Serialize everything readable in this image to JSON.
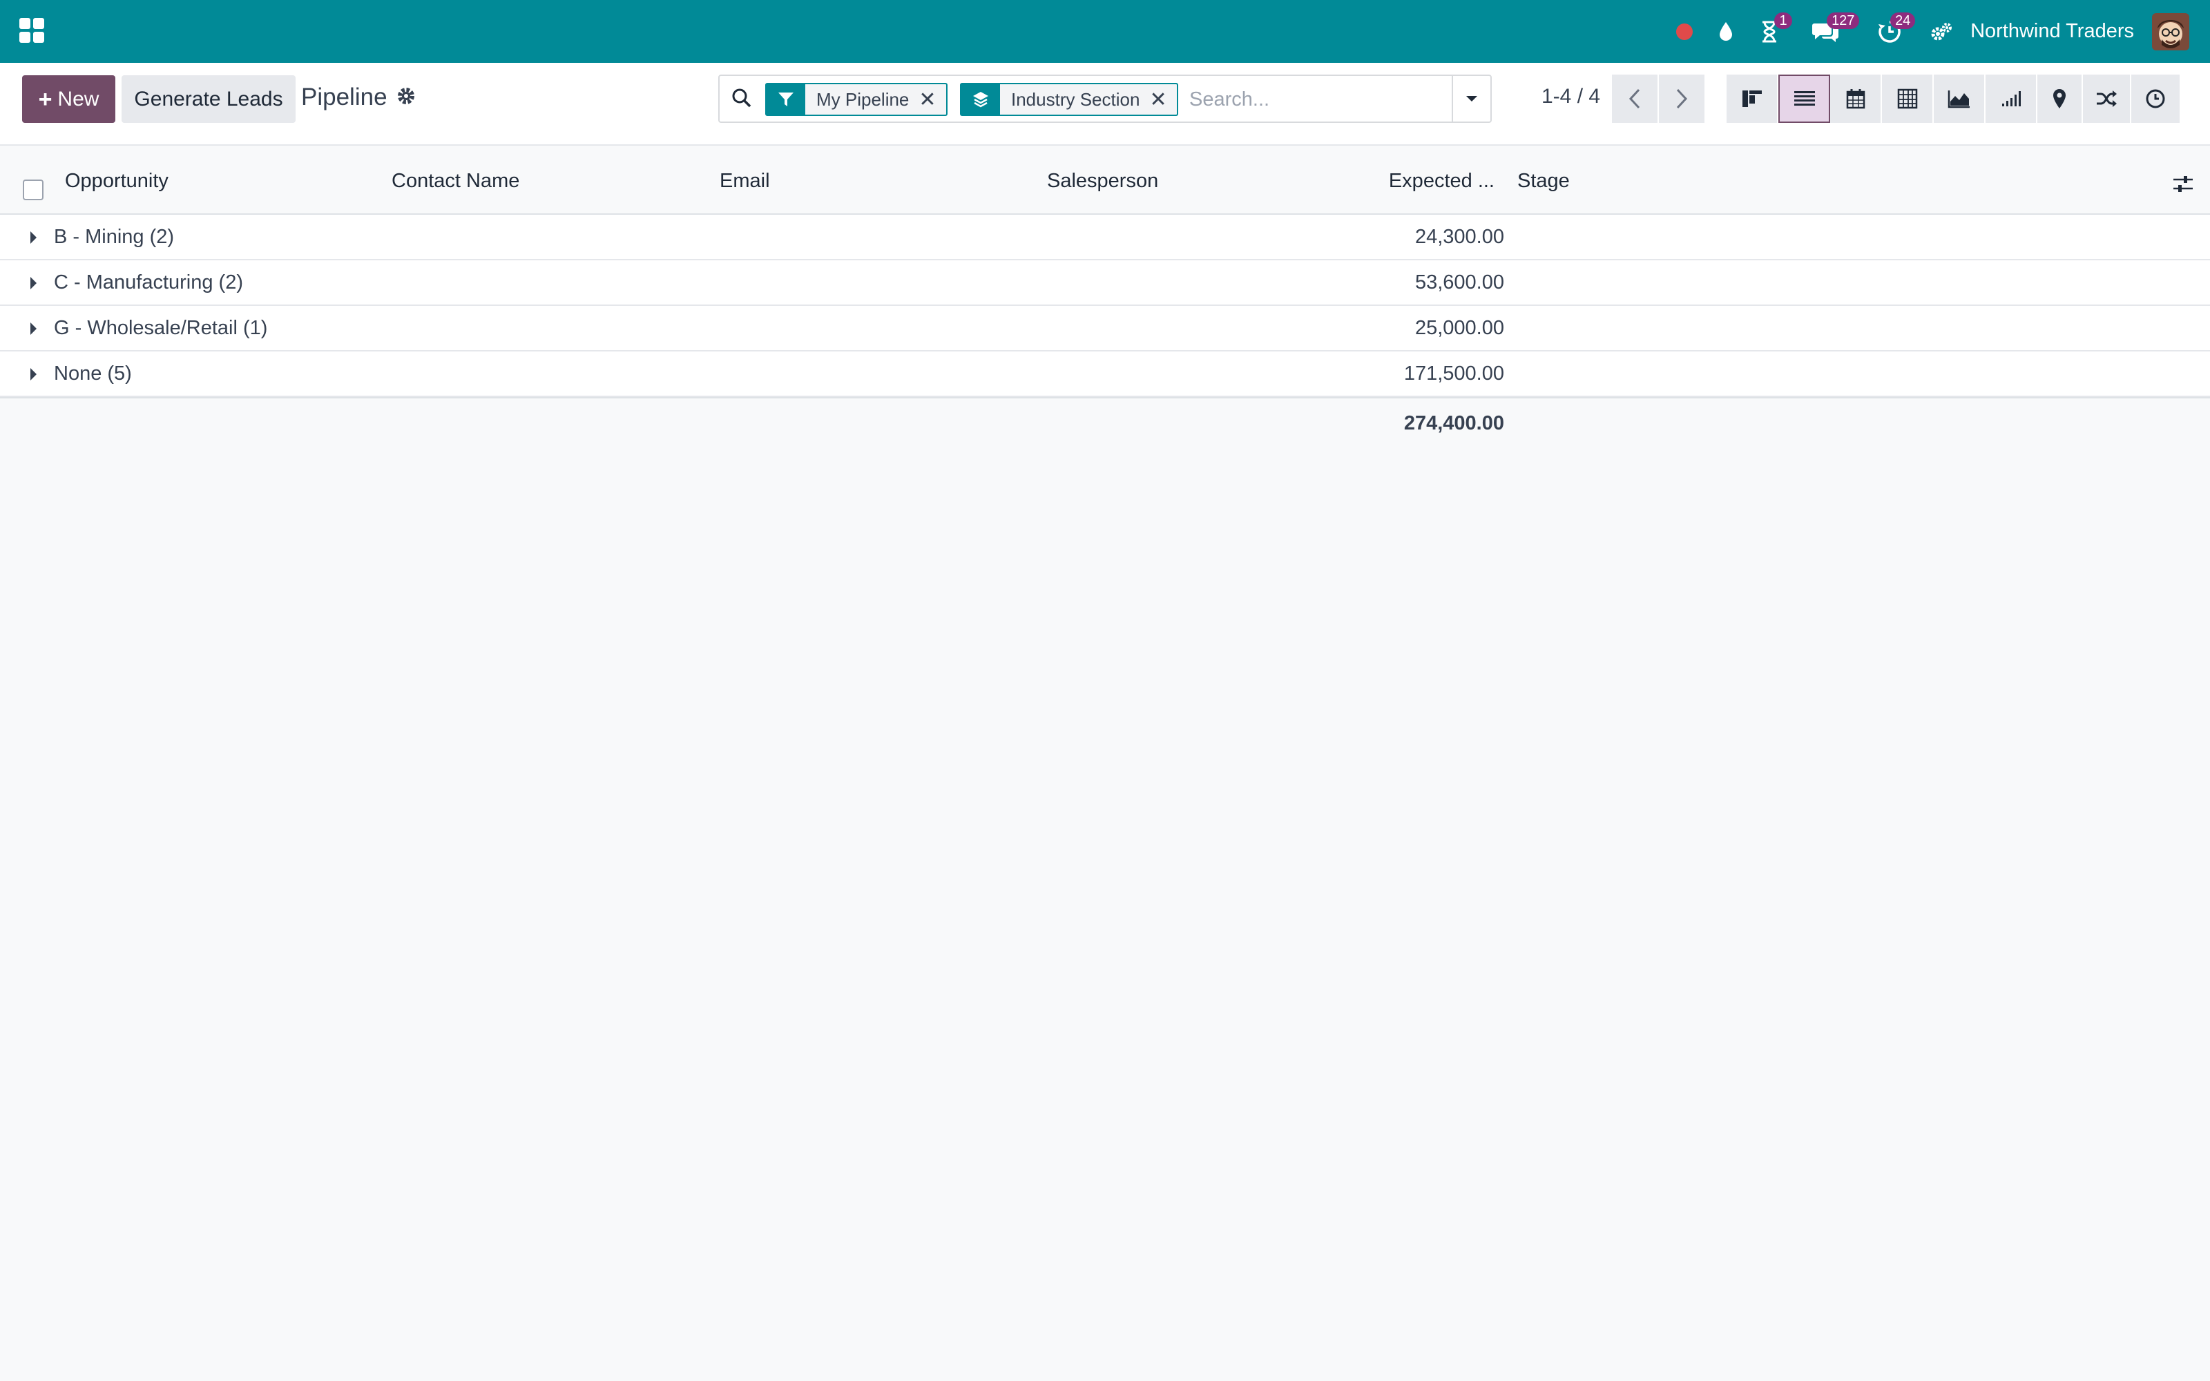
{
  "navbar": {
    "apps_icon": "grid-apps-icon",
    "systray": [
      {
        "name": "recording-dot",
        "icon": "red-dot"
      },
      {
        "name": "drop-icon",
        "icon": "drop"
      },
      {
        "name": "activity",
        "icon": "hourglass",
        "badge": "1"
      },
      {
        "name": "messaging",
        "icon": "chat-bubbles",
        "badge": "127"
      },
      {
        "name": "timer",
        "icon": "clock-arrow",
        "badge": "24"
      },
      {
        "name": "switch-company",
        "icon": "gears"
      }
    ],
    "company": "Northwind Traders",
    "colors": {
      "bar": "#018a97",
      "badge": "#8e2c7e"
    }
  },
  "control_panel": {
    "new_label": "New",
    "generate_label": "Generate Leads",
    "title": "Pipeline",
    "search": {
      "facets": [
        {
          "icon": "filter-icon",
          "label": "My Pipeline"
        },
        {
          "icon": "group-by-layers-icon",
          "label": "Industry Section"
        }
      ],
      "placeholder": "Search..."
    },
    "pager": "1-4 / 4",
    "views": [
      "kanban",
      "list",
      "calendar",
      "pivot",
      "graph",
      "cohort",
      "map",
      "activity-shuffle",
      "activity-clock"
    ],
    "active_view": "list"
  },
  "list": {
    "columns": [
      "Opportunity",
      "Contact Name",
      "Email",
      "Salesperson",
      "Expected ...",
      "Stage"
    ],
    "groups": [
      {
        "name": "B - Mining (2)",
        "amount": "24,300.00"
      },
      {
        "name": "C - Manufacturing (2)",
        "amount": "53,600.00"
      },
      {
        "name": "G - Wholesale/Retail (1)",
        "amount": "25,000.00"
      },
      {
        "name": "None (5)",
        "amount": "171,500.00"
      }
    ],
    "total": "274,400.00"
  }
}
